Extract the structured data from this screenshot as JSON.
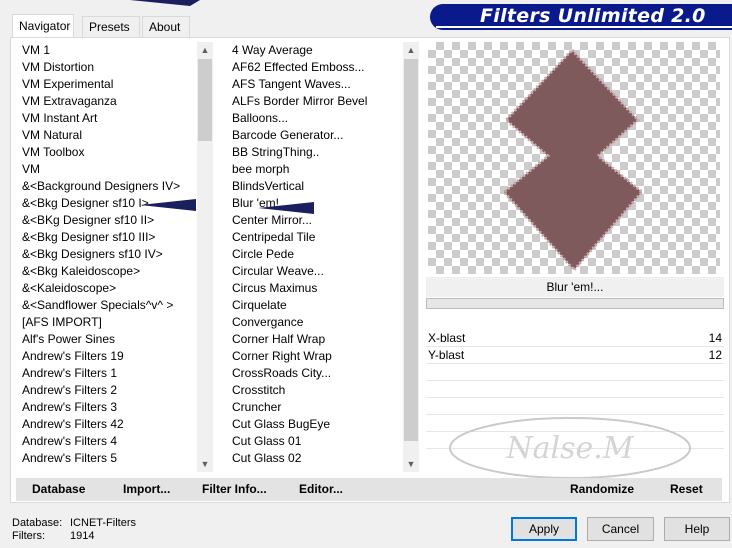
{
  "header": {
    "title": "Filters Unlimited 2.0"
  },
  "tabs": [
    {
      "label": "Navigator",
      "active": true
    },
    {
      "label": "Presets",
      "active": false
    },
    {
      "label": "About",
      "active": false
    }
  ],
  "categories": [
    "VM 1",
    "VM Distortion",
    "VM Experimental",
    "VM Extravaganza",
    "VM Instant Art",
    "VM Natural",
    "VM Toolbox",
    "VM",
    "&<Background Designers IV>",
    "&<Bkg Designer sf10 I>",
    "&<BKg Designer sf10 II>",
    "&<Bkg Designer sf10 III>",
    "&<Bkg Designers sf10 IV>",
    "&<Bkg Kaleidoscope>",
    "&<Kaleidoscope>",
    "&<Sandflower Specials^v^ >",
    "[AFS IMPORT]",
    "Alf's Power Sines",
    "Andrew's Filters 19",
    "Andrew's Filters 1",
    "Andrew's Filters 2",
    "Andrew's Filters 3",
    "Andrew's Filters 42",
    "Andrew's Filters 4",
    "Andrew's Filters 5"
  ],
  "filters": [
    "4 Way Average",
    "AF62 Effected Emboss...",
    "AFS Tangent Waves...",
    "ALFs Border Mirror Bevel",
    "Balloons...",
    "Barcode Generator...",
    "BB StringThing..",
    "bee morph",
    "BlindsVertical",
    "Blur 'em!...",
    "Center Mirror...",
    "Centripedal Tile",
    "Circle Pede",
    "Circular Weave...",
    "Circus Maximus",
    "Cirquelate",
    "Convergance",
    "Corner Half Wrap",
    "Corner Right Wrap",
    "CrossRoads City...",
    "Crosstitch",
    "Cruncher",
    "Cut Glass  BugEye",
    "Cut Glass 01",
    "Cut Glass 02"
  ],
  "preview": {
    "selected_filter": "Blur 'em!...",
    "shape_color": "#7f5a5c",
    "watermark": "Nalse.M"
  },
  "params": [
    {
      "label": "X-blast",
      "value": "14"
    },
    {
      "label": "Y-blast",
      "value": "12"
    }
  ],
  "toolbar": {
    "database": "Database",
    "import": "Import...",
    "filter_info": "Filter Info...",
    "editor": "Editor...",
    "randomize": "Randomize",
    "reset": "Reset"
  },
  "status": {
    "database_label": "Database:",
    "database_value": "ICNET-Filters",
    "filters_label": "Filters:",
    "filters_value": "1914"
  },
  "buttons": {
    "apply": "Apply",
    "cancel": "Cancel",
    "help": "Help"
  },
  "colors": {
    "accent": "#0a1a8c",
    "focus": "#0078d7"
  }
}
